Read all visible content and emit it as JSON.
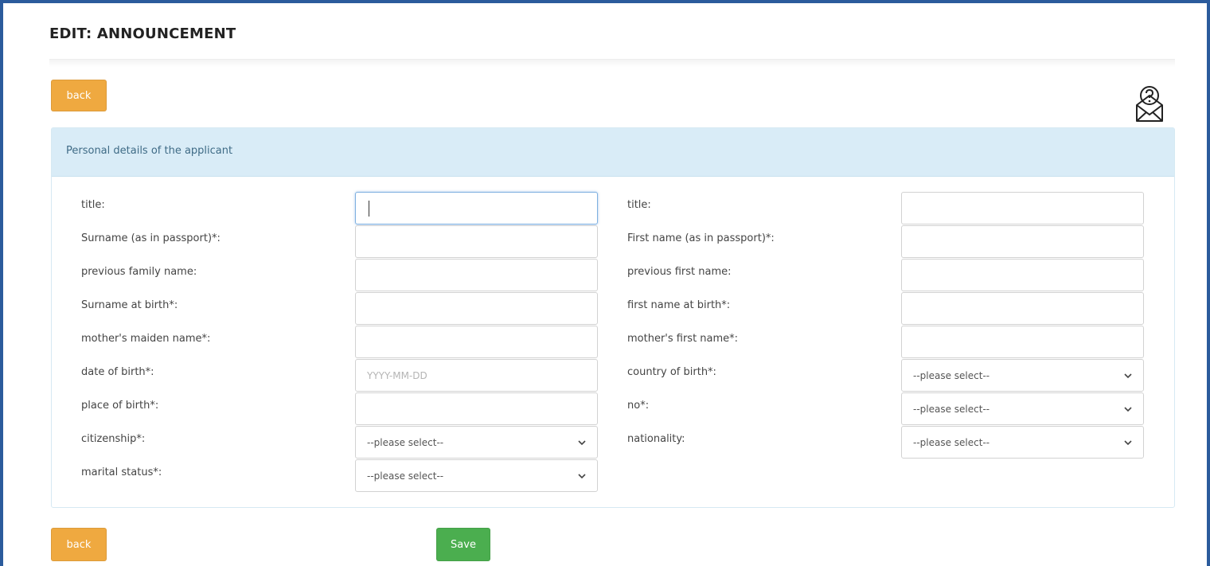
{
  "header": {
    "title": "EDIT: ANNOUNCEMENT"
  },
  "top_actions": {
    "back_label": "back"
  },
  "bottom_actions": {
    "back_label": "back",
    "save_label": "Save"
  },
  "help": {
    "icon": "envelope-question-icon"
  },
  "panel": {
    "heading": "Personal details of the applicant"
  },
  "left_fields": [
    {
      "label": "title:",
      "type": "text",
      "value": ""
    },
    {
      "label": "Surname (as in passport)*:",
      "type": "text",
      "value": ""
    },
    {
      "label": "previous family name:",
      "type": "text",
      "value": ""
    },
    {
      "label": "Surname at birth*:",
      "type": "text",
      "value": ""
    },
    {
      "label": "mother's maiden name*:",
      "type": "text",
      "value": ""
    },
    {
      "label": "date of birth*:",
      "type": "text",
      "value": "",
      "placeholder": "YYYY-MM-DD"
    },
    {
      "label": "place of birth*:",
      "type": "text",
      "value": ""
    },
    {
      "label": "citizenship*:",
      "type": "select",
      "value": "--please select--"
    },
    {
      "label": "marital status*:",
      "type": "select",
      "value": "--please select--"
    }
  ],
  "right_fields": [
    {
      "label": "title:",
      "type": "text",
      "value": ""
    },
    {
      "label": "First name (as in passport)*:",
      "type": "text",
      "value": ""
    },
    {
      "label": "previous first name:",
      "type": "text",
      "value": ""
    },
    {
      "label": "first name at birth*:",
      "type": "text",
      "value": ""
    },
    {
      "label": "mother's first name*:",
      "type": "text",
      "value": ""
    },
    {
      "label": "country of birth*:",
      "type": "select",
      "value": "--please select--"
    },
    {
      "label": "no*:",
      "type": "select",
      "value": "--please select--"
    },
    {
      "label": "nationality:",
      "type": "select",
      "value": "--please select--"
    }
  ],
  "colors": {
    "frame": "#2b5b9c",
    "back_button": "#efa940",
    "save_button": "#4bae4f",
    "panel_header": "#d9ecf7"
  }
}
